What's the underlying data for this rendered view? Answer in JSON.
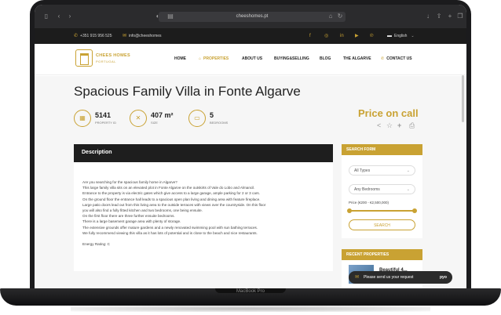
{
  "device": {
    "model_label": "MacBook Pro"
  },
  "browser": {
    "url": "cheeshomes.pt",
    "icons": [
      "sidebar-icon",
      "back-icon",
      "forward-icon",
      "shield-icon",
      "tab-icon",
      "translate-icon",
      "refresh-icon",
      "download-icon",
      "share-icon",
      "new-tab-icon",
      "tabs-icon"
    ]
  },
  "top_strip": {
    "phone": "+351 915 956 525",
    "email": "info@cheeshomes",
    "language": "English"
  },
  "nav": {
    "logo_title": "CHEES HOMES",
    "logo_sub": "PORTUGAL",
    "links": [
      "HOME",
      "PROPERTIES",
      "ABOUT US",
      "BUYING&SELLING",
      "BLOG",
      "THE ALGARVE",
      "CONTACT US"
    ]
  },
  "hero": {
    "title": "Spacious Family Villa in Fonte Algarve",
    "stats": [
      {
        "value": "5141",
        "label": "PROPERTY ID"
      },
      {
        "value": "407 m²",
        "label": "SIZE"
      },
      {
        "value": "5",
        "label": "BEDROOMS"
      }
    ],
    "price": "Price on call"
  },
  "description": {
    "heading": "Description",
    "lines": [
      "Are you searching for the spacious family home in Algarve?",
      "This large family villa sits on an elevated plot in Fonte Algarve on the outskirts of Vale do Lobo and Almancil.",
      "Entrance to the property is via electric gates which give access to a large garage, ample parking for 2 or 3 cars.",
      "On the ground floor the entrance hall leads to a spacious open plan living and dining area with feature fireplace.",
      "Large patio doors lead out from this living area to the outside terraces with views over the countryside. On this floor",
      "you will also find a fully fitted kitchen and two bedrooms, one being ensuite.",
      "On the first floor there are three further ensuite bedrooms.",
      "There is a large basement garage area with plenty of storage.",
      "The extensive grounds offer mature gardens and a newly renovated swimming pool with sun bathing terraces.",
      "We fully recommend viewing this villa as it has lots of potential and is  close to the beach and nice restaurants."
    ],
    "energy": "Energy Rating: C"
  },
  "search_form": {
    "heading": "SEARCH FORM",
    "type_select": "All Types",
    "bedroom_select": "Any Bedrooms",
    "price_range": "Price (€200 - €2,500,000)",
    "price_min_fraction": 0.0,
    "price_max_fraction": 1.0,
    "button": "SEARCH"
  },
  "recent": {
    "heading": "RECENT PROPERTIES",
    "item_name": "Beautiful 4..."
  },
  "chat": {
    "text": "Please send us your request",
    "lang": "pyo"
  },
  "colors": {
    "accent": "#c9a233",
    "dark": "#1e1e1e",
    "background": "#f6f6f6"
  }
}
